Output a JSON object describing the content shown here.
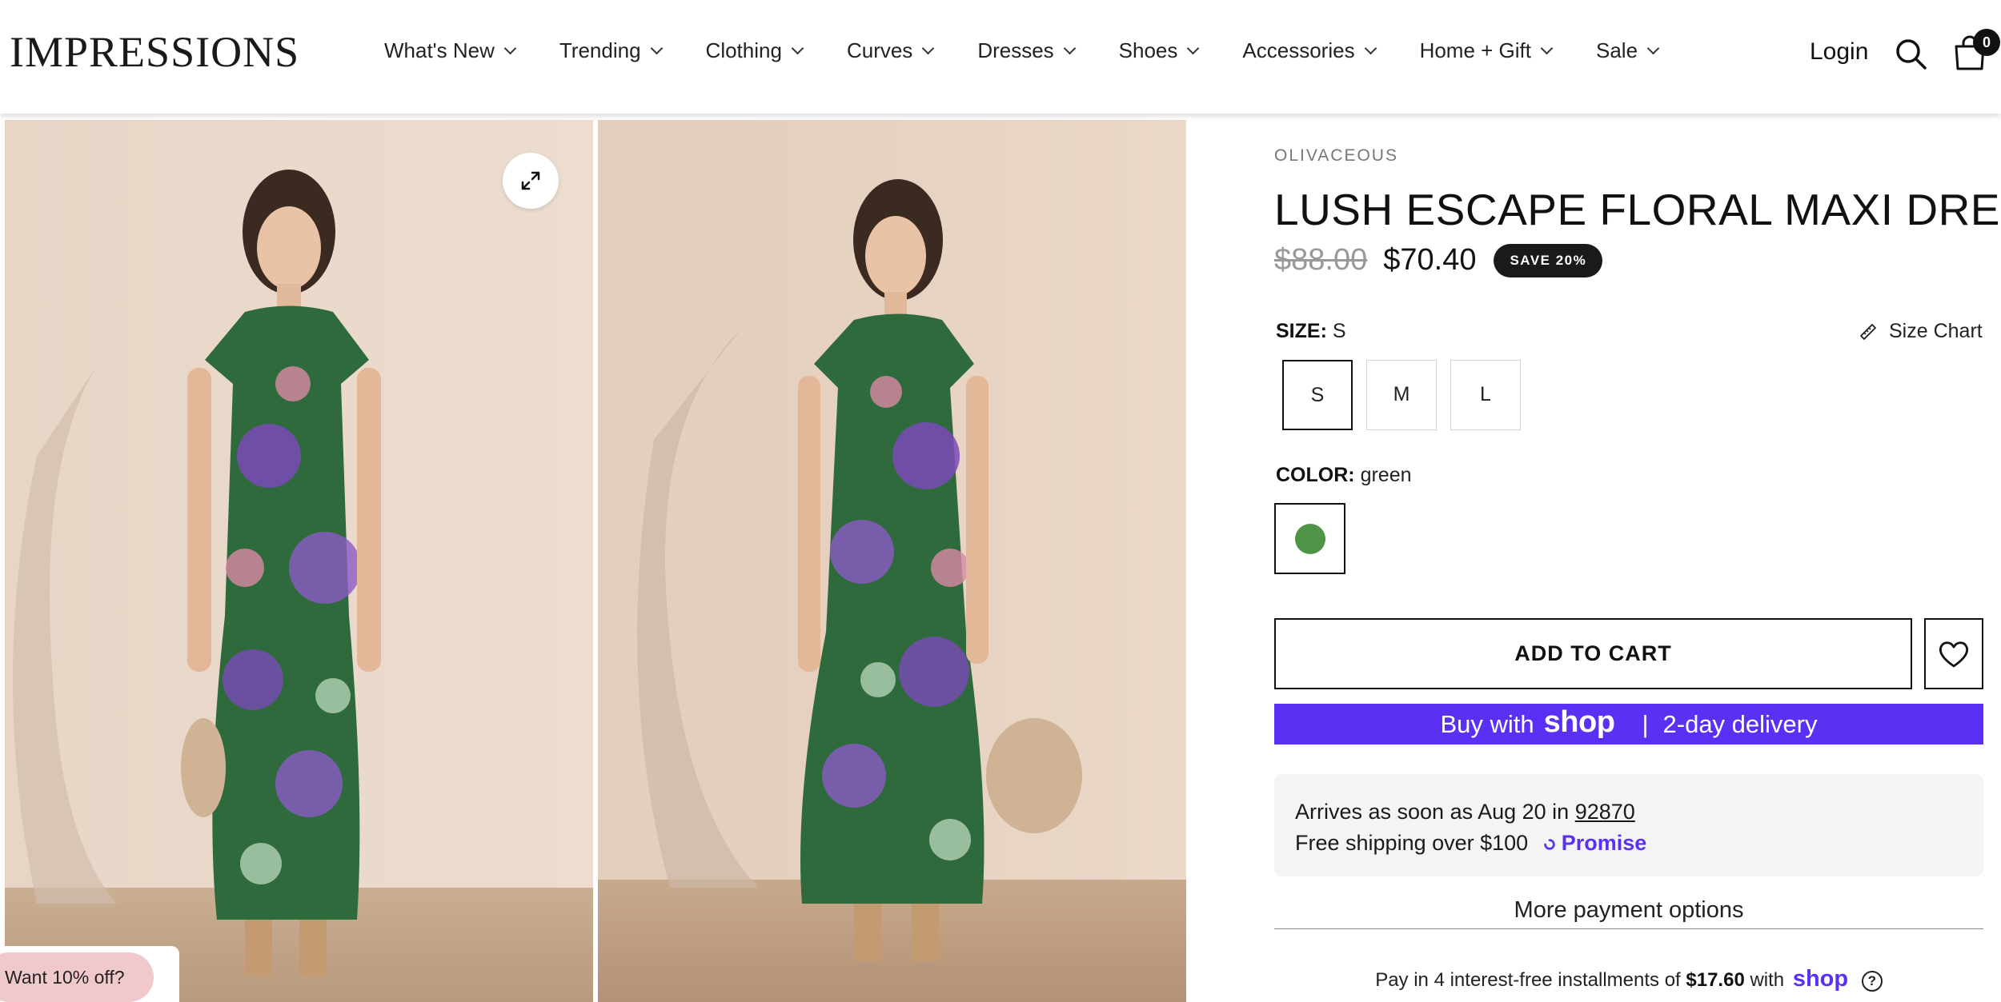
{
  "header": {
    "logo": "IMPRESSIONS",
    "nav": [
      {
        "label": "What's New"
      },
      {
        "label": "Trending"
      },
      {
        "label": "Clothing"
      },
      {
        "label": "Curves"
      },
      {
        "label": "Dresses"
      },
      {
        "label": "Shoes"
      },
      {
        "label": "Accessories"
      },
      {
        "label": "Home + Gift"
      },
      {
        "label": "Sale"
      }
    ],
    "login_label": "Login",
    "cart_count": "0",
    "icons": [
      "search-icon",
      "cart-icon",
      "chevron-down-icon"
    ]
  },
  "gallery": {
    "expand_icon": "expand-icon",
    "promo_label": "Want 10% off?"
  },
  "product": {
    "brand": "OLIVACEOUS",
    "title": "LUSH ESCAPE FLORAL MAXI DRESS",
    "compare_price": "$88.00",
    "price": "$70.40",
    "save_badge": "SAVE 20%",
    "size": {
      "label": "SIZE:",
      "selected": "S",
      "options": [
        "S",
        "M",
        "L"
      ],
      "size_chart_label": "Size Chart"
    },
    "color": {
      "label": "COLOR:",
      "selected": "green",
      "swatch_hex": "#4e9446"
    },
    "add_to_cart_label": "ADD TO CART",
    "shop_pay": {
      "prefix": "Buy with",
      "brand": "shop",
      "separator": "|",
      "suffix": "2-day delivery",
      "color": "#5a31f4"
    },
    "delivery": {
      "arrival_prefix": "Arrives as soon as Aug 20 in",
      "zip": "92870",
      "shipping": "Free shipping over $100",
      "promise_label": "Promise",
      "promise_color": "#5a31f4"
    },
    "more_payment_label": "More payment options",
    "installments": {
      "prefix": "Pay in 4 interest-free installments of",
      "amount": "$17.60",
      "middle": "with",
      "brand": "shop",
      "help": "?"
    }
  }
}
